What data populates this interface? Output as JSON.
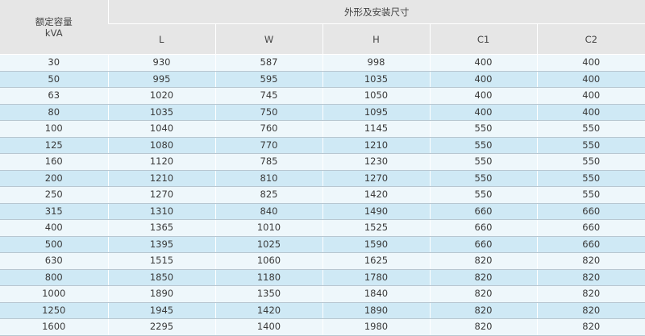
{
  "header": {
    "capacity_label_line1": "额定容量",
    "capacity_label_line2": "kVA",
    "dimensions_label": "外形及安装尺寸",
    "columns": [
      "L",
      "W",
      "H",
      "C1",
      "C2"
    ]
  },
  "rows": [
    [
      "30",
      "930",
      "587",
      "998",
      "400",
      "400"
    ],
    [
      "50",
      "995",
      "595",
      "1035",
      "400",
      "400"
    ],
    [
      "63",
      "1020",
      "745",
      "1050",
      "400",
      "400"
    ],
    [
      "80",
      "1035",
      "750",
      "1095",
      "400",
      "400"
    ],
    [
      "100",
      "1040",
      "760",
      "1145",
      "550",
      "550"
    ],
    [
      "125",
      "1080",
      "770",
      "1210",
      "550",
      "550"
    ],
    [
      "160",
      "1120",
      "785",
      "1230",
      "550",
      "550"
    ],
    [
      "200",
      "1210",
      "810",
      "1270",
      "550",
      "550"
    ],
    [
      "250",
      "1270",
      "825",
      "1420",
      "550",
      "550"
    ],
    [
      "315",
      "1310",
      "840",
      "1490",
      "660",
      "660"
    ],
    [
      "400",
      "1365",
      "1010",
      "1525",
      "660",
      "660"
    ],
    [
      "500",
      "1395",
      "1025",
      "1590",
      "660",
      "660"
    ],
    [
      "630",
      "1515",
      "1060",
      "1625",
      "820",
      "820"
    ],
    [
      "800",
      "1850",
      "1180",
      "1780",
      "820",
      "820"
    ],
    [
      "1000",
      "1890",
      "1350",
      "1840",
      "820",
      "820"
    ],
    [
      "1250",
      "1945",
      "1420",
      "1890",
      "820",
      "820"
    ],
    [
      "1600",
      "2295",
      "1400",
      "1980",
      "820",
      "820"
    ]
  ]
}
